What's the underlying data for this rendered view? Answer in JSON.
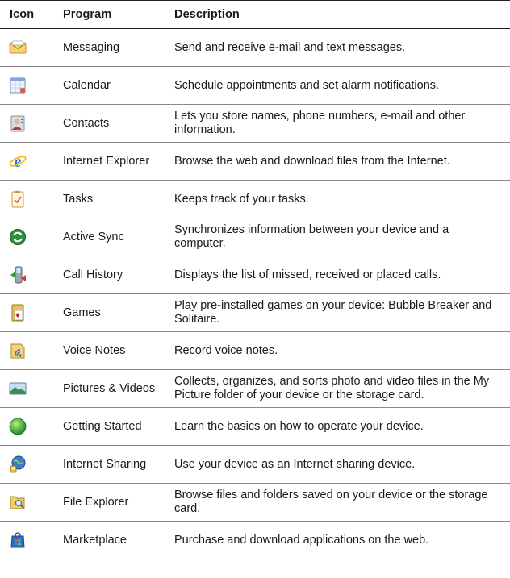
{
  "table": {
    "headers": {
      "icon": "Icon",
      "program": "Program",
      "description": "Description"
    },
    "rows": [
      {
        "icon": "envelope-icon",
        "program": "Messaging",
        "description": "Send and receive e-mail and text messages."
      },
      {
        "icon": "calendar-icon",
        "program": "Calendar",
        "description": "Schedule appointments and set alarm notifications."
      },
      {
        "icon": "contacts-icon",
        "program": "Contacts",
        "description": "Lets you store names, phone numbers, e-mail and other information."
      },
      {
        "icon": "internet-explorer-icon",
        "program": "Internet Explorer",
        "description": "Browse the web and download files from the Internet."
      },
      {
        "icon": "tasks-icon",
        "program": "Tasks",
        "description": "Keeps track of your tasks."
      },
      {
        "icon": "activesync-icon",
        "program": "Active Sync",
        "description": "Synchronizes information between your device and a computer."
      },
      {
        "icon": "call-history-icon",
        "program": "Call History",
        "description": "Displays the list of missed, received or placed calls."
      },
      {
        "icon": "games-icon",
        "program": "Games",
        "description": "Play pre-installed games on your device: Bubble Breaker and Solitaire."
      },
      {
        "icon": "voice-notes-icon",
        "program": "Voice Notes",
        "description": "Record voice notes."
      },
      {
        "icon": "pictures-icon",
        "program": "Pictures & Videos",
        "description": "Collects, organizes, and sorts photo and video files in the My Picture folder of your device or the storage card."
      },
      {
        "icon": "getting-started-icon",
        "program": "Getting Started",
        "description": "Learn the basics on how to operate your device."
      },
      {
        "icon": "internet-sharing-icon",
        "program": "Internet Sharing",
        "description": "Use your device as an Internet sharing device."
      },
      {
        "icon": "file-explorer-icon",
        "program": "File Explorer",
        "description": "Browse files and folders saved on your device or the storage card."
      },
      {
        "icon": "marketplace-icon",
        "program": "Marketplace",
        "description": "Purchase and download applications on the web."
      }
    ]
  }
}
